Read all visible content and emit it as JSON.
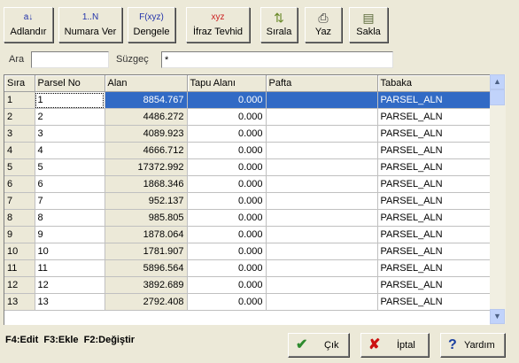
{
  "toolbar": {
    "buttons": [
      {
        "label": "Adlandır",
        "icon": "ab-icon",
        "glyph": "a↓"
      },
      {
        "label": "Numara Ver",
        "icon": "1-n-icon",
        "glyph": "1..N"
      },
      {
        "label": "Dengele",
        "icon": "fxyz-icon",
        "glyph": "F(xyz)"
      },
      {
        "label": "İfraz Tevhid",
        "icon": "xyz-plus-icon",
        "glyph": "xyz"
      },
      {
        "label": "Sırala",
        "icon": "sort-icon",
        "glyph": "⇅"
      },
      {
        "label": "Yaz",
        "icon": "printer-icon",
        "glyph": "⎙"
      },
      {
        "label": "Sakla",
        "icon": "save-icon",
        "glyph": "▤"
      }
    ]
  },
  "search": {
    "ara_label": "Ara",
    "ara_value": "",
    "suzgec_label": "Süzgeç",
    "suzgec_value": "*"
  },
  "table": {
    "columns": [
      "Sıra",
      "Parsel No",
      "Alan",
      "Tapu Alanı",
      "Pafta",
      "Tabaka"
    ],
    "rows": [
      [
        "1",
        "1",
        "8854.767",
        "0.000",
        "",
        "PARSEL_ALN"
      ],
      [
        "2",
        "2",
        "4486.272",
        "0.000",
        "",
        "PARSEL_ALN"
      ],
      [
        "3",
        "3",
        "4089.923",
        "0.000",
        "",
        "PARSEL_ALN"
      ],
      [
        "4",
        "4",
        "4666.712",
        "0.000",
        "",
        "PARSEL_ALN"
      ],
      [
        "5",
        "5",
        "17372.992",
        "0.000",
        "",
        "PARSEL_ALN"
      ],
      [
        "6",
        "6",
        "1868.346",
        "0.000",
        "",
        "PARSEL_ALN"
      ],
      [
        "7",
        "7",
        "952.137",
        "0.000",
        "",
        "PARSEL_ALN"
      ],
      [
        "8",
        "8",
        "985.805",
        "0.000",
        "",
        "PARSEL_ALN"
      ],
      [
        "9",
        "9",
        "1878.064",
        "0.000",
        "",
        "PARSEL_ALN"
      ],
      [
        "10",
        "10",
        "1781.907",
        "0.000",
        "",
        "PARSEL_ALN"
      ],
      [
        "11",
        "11",
        "5896.564",
        "0.000",
        "",
        "PARSEL_ALN"
      ],
      [
        "12",
        "12",
        "3892.689",
        "0.000",
        "",
        "PARSEL_ALN"
      ],
      [
        "13",
        "13",
        "2792.408",
        "0.000",
        "",
        "PARSEL_ALN"
      ]
    ],
    "selected_row": 0
  },
  "footer": {
    "hint": "F4:Edit  F3:Ekle  F2:Değiştir",
    "ok_label": "Çık",
    "cancel_label": "İptal",
    "help_label": "Yardım"
  },
  "colors": {
    "selection": "#316ac5",
    "ok_icon": "#2e8b2e",
    "cancel_icon": "#cc1111",
    "help_icon": "#1a3fa0"
  }
}
